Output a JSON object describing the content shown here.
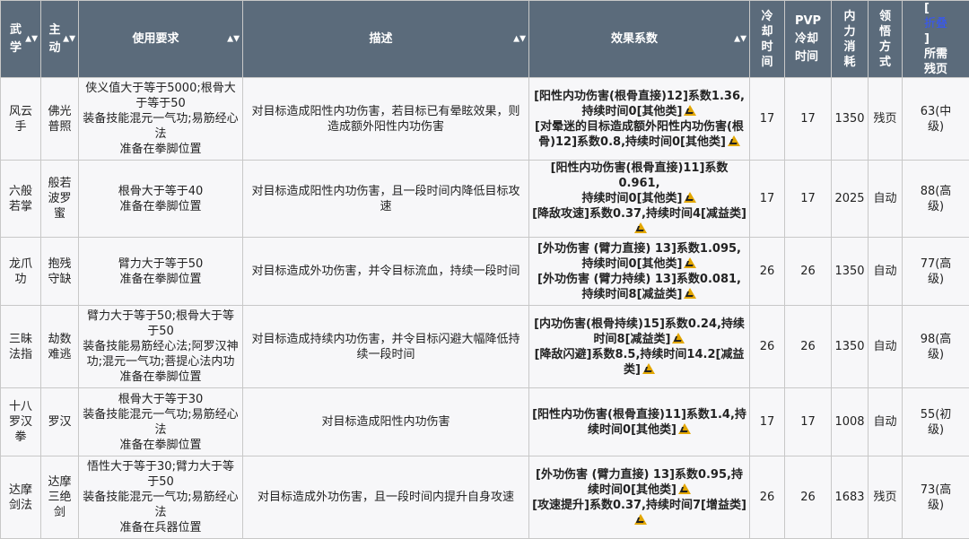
{
  "headers": {
    "skill": [
      "武",
      "学"
    ],
    "school": [
      "主",
      "动"
    ],
    "requirement": "使用要求",
    "description": "描述",
    "effect": "效果系数",
    "cooldown": [
      "冷",
      "却",
      "时",
      "间"
    ],
    "pvp_cooldown": [
      "PVP",
      "冷却",
      "时间"
    ],
    "mana": [
      "内",
      "力",
      "消",
      "耗"
    ],
    "learn_method": [
      "领",
      "悟",
      "方",
      "式"
    ],
    "pages": {
      "open_bracket": "[",
      "fold": "折叠",
      "close_bracket": "]",
      "line2": "所需",
      "line3": "残页"
    }
  },
  "rows": [
    {
      "skill": [
        "风云",
        "手"
      ],
      "school": [
        "佛光",
        "普照"
      ],
      "requirement": [
        "侠义值大于等于5000;根骨大",
        "于等于50",
        "装备技能混元一气功;易筋经心",
        "法",
        "准备在拳脚位置"
      ],
      "description": [
        "对目标造成阳性内功伤害，若目标已有晕眩效果，则",
        "造成额外阳性内功伤害"
      ],
      "effects": [
        "[阳性内功伤害(根骨直接)12]系数1.36,",
        "持续时间0[其他类]",
        "[对晕迷的目标造成额外阳性内功伤害(根",
        "骨)12]系数0.8,持续时间0[其他类]"
      ],
      "warn_lines": [
        1,
        3
      ],
      "cooldown": "17",
      "pvp_cooldown": "17",
      "mana": "1350",
      "learn": "残页",
      "pages": [
        "63(中",
        "级)"
      ]
    },
    {
      "skill": [
        "六般",
        "若掌"
      ],
      "school": [
        "般若",
        "波罗",
        "蜜"
      ],
      "requirement": [
        "根骨大于等于40",
        "准备在拳脚位置"
      ],
      "description": [
        "对目标造成阳性内功伤害，且一段时间内降低目标攻",
        "速"
      ],
      "effects": [
        "[阳性内功伤害(根骨直接)11]系数0.961,",
        "持续时间0[其他类]",
        "[降敌攻速]系数0.37,持续时间4[减益类]",
        ""
      ],
      "warn_lines": [
        1,
        3
      ],
      "cooldown": "17",
      "pvp_cooldown": "17",
      "mana": "2025",
      "learn": "自动",
      "pages": [
        "88(高",
        "级)"
      ]
    },
    {
      "skill": [
        "龙爪",
        "功"
      ],
      "school": [
        "抱残",
        "守缺"
      ],
      "requirement": [
        "臂力大于等于50",
        "准备在拳脚位置"
      ],
      "description": [
        "对目标造成外功伤害，并令目标流血，持续一段时间"
      ],
      "effects": [
        "[外功伤害 (臂力直接) 13]系数1.095,",
        "持续时间0[其他类]",
        "[外功伤害 (臂力持续) 13]系数0.081,",
        "持续时间8[减益类]"
      ],
      "warn_lines": [
        1,
        3
      ],
      "cooldown": "26",
      "pvp_cooldown": "26",
      "mana": "1350",
      "learn": "自动",
      "pages": [
        "77(高",
        "级)"
      ]
    },
    {
      "skill": [
        "三昧",
        "法指"
      ],
      "school": [
        "劫数",
        "难逃"
      ],
      "requirement": [
        "臂力大于等于50;根骨大于等",
        "于50",
        "装备技能易筋经心法;阿罗汉神",
        "功;混元一气功;菩提心法内功",
        "准备在拳脚位置"
      ],
      "description": [
        "对目标造成持续内功伤害，并令目标闪避大幅降低持",
        "续一段时间"
      ],
      "effects": [
        "[内功伤害(根骨持续)15]系数0.24,持续",
        "时间8[减益类]",
        "[降敌闪避]系数8.5,持续时间14.2[减益",
        "类]"
      ],
      "warn_lines": [
        1,
        3
      ],
      "cooldown": "26",
      "pvp_cooldown": "26",
      "mana": "1350",
      "learn": "自动",
      "pages": [
        "98(高",
        "级)"
      ]
    },
    {
      "skill": [
        "十八",
        "罗汉",
        "拳"
      ],
      "school": [
        "罗汉"
      ],
      "requirement": [
        "根骨大于等于30",
        "装备技能混元一气功;易筋经心",
        "法",
        "准备在拳脚位置"
      ],
      "description": [
        "对目标造成阳性内功伤害"
      ],
      "effects": [
        "[阳性内功伤害(根骨直接)11]系数1.4,持",
        "续时间0[其他类]"
      ],
      "warn_lines": [
        1
      ],
      "cooldown": "17",
      "pvp_cooldown": "17",
      "mana": "1008",
      "learn": "自动",
      "pages": [
        "55(初",
        "级)"
      ]
    },
    {
      "skill": [
        "达摩",
        "剑法"
      ],
      "school": [
        "达摩",
        "三绝",
        "剑"
      ],
      "requirement": [
        "悟性大于等于30;臂力大于等",
        "于50",
        "装备技能混元一气功;易筋经心",
        "法",
        "准备在兵器位置"
      ],
      "description": [
        "对目标造成外功伤害，且一段时间内提升自身攻速"
      ],
      "effects": [
        "[外功伤害 (臂力直接) 13]系数0.95,持",
        "续时间0[其他类]",
        "[攻速提升]系数0.37,持续时间7[增益类]",
        ""
      ],
      "warn_lines": [
        1,
        3
      ],
      "cooldown": "26",
      "pvp_cooldown": "26",
      "mana": "1683",
      "learn": "残页",
      "pages": [
        "73(高",
        "级)"
      ]
    }
  ]
}
